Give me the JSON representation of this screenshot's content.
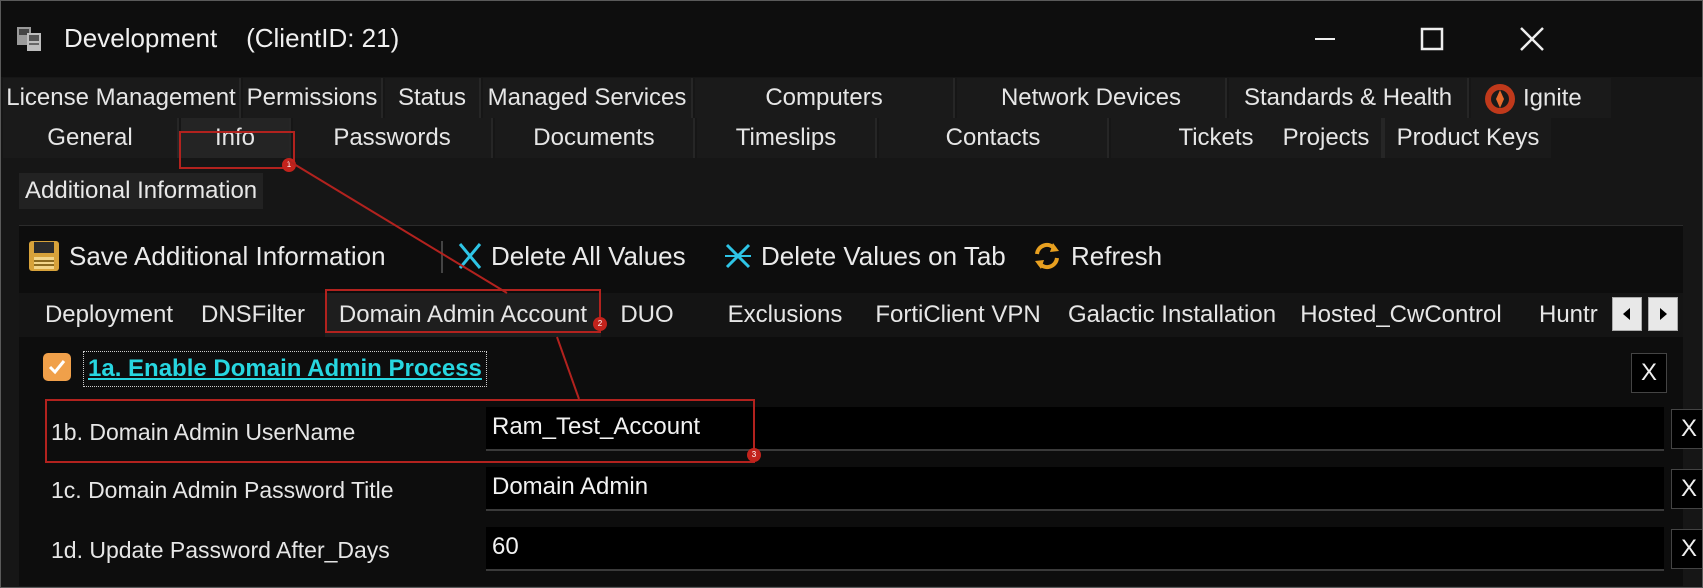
{
  "window": {
    "title": "Development    (ClientID: 21)",
    "controls": {
      "minimize": "—",
      "maximize": "☐",
      "close": "✕"
    }
  },
  "tabs_row1": [
    "License Management",
    "Permissions",
    "Status",
    "Managed Services",
    "Computers",
    "Network Devices",
    "Standards & Health",
    "Ignite"
  ],
  "tabs_row2": [
    "General",
    "Info",
    "Passwords",
    "Documents",
    "Timeslips",
    "Contacts",
    "Tickets",
    "Projects",
    "Product Keys"
  ],
  "selected_tab": "Info",
  "section_header": "Additional Information",
  "toolbar": {
    "save": "Save Additional Information",
    "delete_all": "Delete All Values",
    "delete_tab": "Delete Values on Tab",
    "refresh": "Refresh"
  },
  "sub_tabs": [
    "Deployment",
    "DNSFilter",
    "Domain Admin Account",
    "DUO",
    "Exclusions",
    "FortiClient VPN",
    "Galactic Installation",
    "Hosted_CwControl",
    "Huntr"
  ],
  "selected_sub_tab": "Domain Admin Account",
  "form": {
    "checkbox_label": "1a. Enable Domain Admin Process",
    "checkbox_checked": true,
    "fields": [
      {
        "label": "1b. Domain Admin UserName",
        "value": "Ram_Test_Account"
      },
      {
        "label": "1c. Domain Admin Password Title",
        "value": "Domain Admin"
      },
      {
        "label": "1d. Update Password After_Days",
        "value": "60"
      }
    ],
    "clear_label": "X"
  },
  "annotations": [
    "1",
    "2",
    "3"
  ],
  "colors": {
    "accent_cyan": "#27d6e0",
    "checkbox": "#f0a04a",
    "annotation_red": "#b2221e",
    "background": "#161616"
  }
}
